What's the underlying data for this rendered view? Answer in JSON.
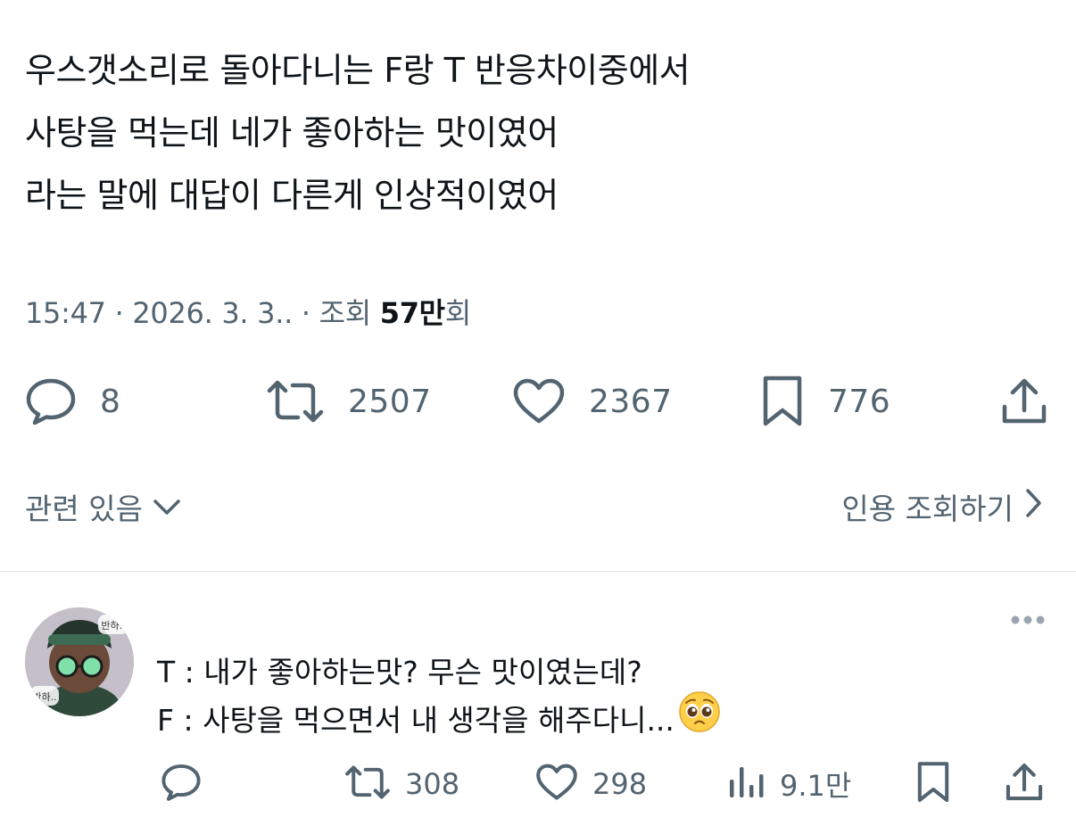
{
  "tweet": {
    "lines": [
      "우스갯소리로 돌아다니는 F랑 T 반응차이중에서",
      "사탕을 먹는데 네가 좋아하는 맛이였어",
      "라는 말에 대답이 다른게 인상적이였어"
    ],
    "time": "15:47",
    "date": "2026. 3. 3.",
    "views_label": "조회",
    "views_count": "57만",
    "views_suffix": "회",
    "sep": "·"
  },
  "actions": {
    "reply_count": "8",
    "retweet_count": "2507",
    "like_count": "2367",
    "bookmark_count": "776"
  },
  "related": {
    "related_label": "관련 있음",
    "quotes_label": "인용 조회하기"
  },
  "reply": {
    "lines": [
      "T : 내가 좋아하는맛? 무슨 맛이였는데?",
      "F : 사탕을 먹으면서 내 생각을 해주다니..."
    ],
    "avatar_bubble_1": "반하..",
    "avatar_bubble_2": "반하..",
    "retweet_count": "308",
    "like_count": "298",
    "view_count": "9.1만"
  },
  "colors": {
    "text": "#0f1419",
    "secondary": "#536471",
    "divider": "#e1e6ea"
  },
  "icons": [
    "reply-icon",
    "retweet-icon",
    "like-icon",
    "bookmark-icon",
    "share-icon",
    "chevron-down-icon",
    "chevron-right-icon",
    "more-icon",
    "views-icon",
    "pleading-face-emoji"
  ]
}
